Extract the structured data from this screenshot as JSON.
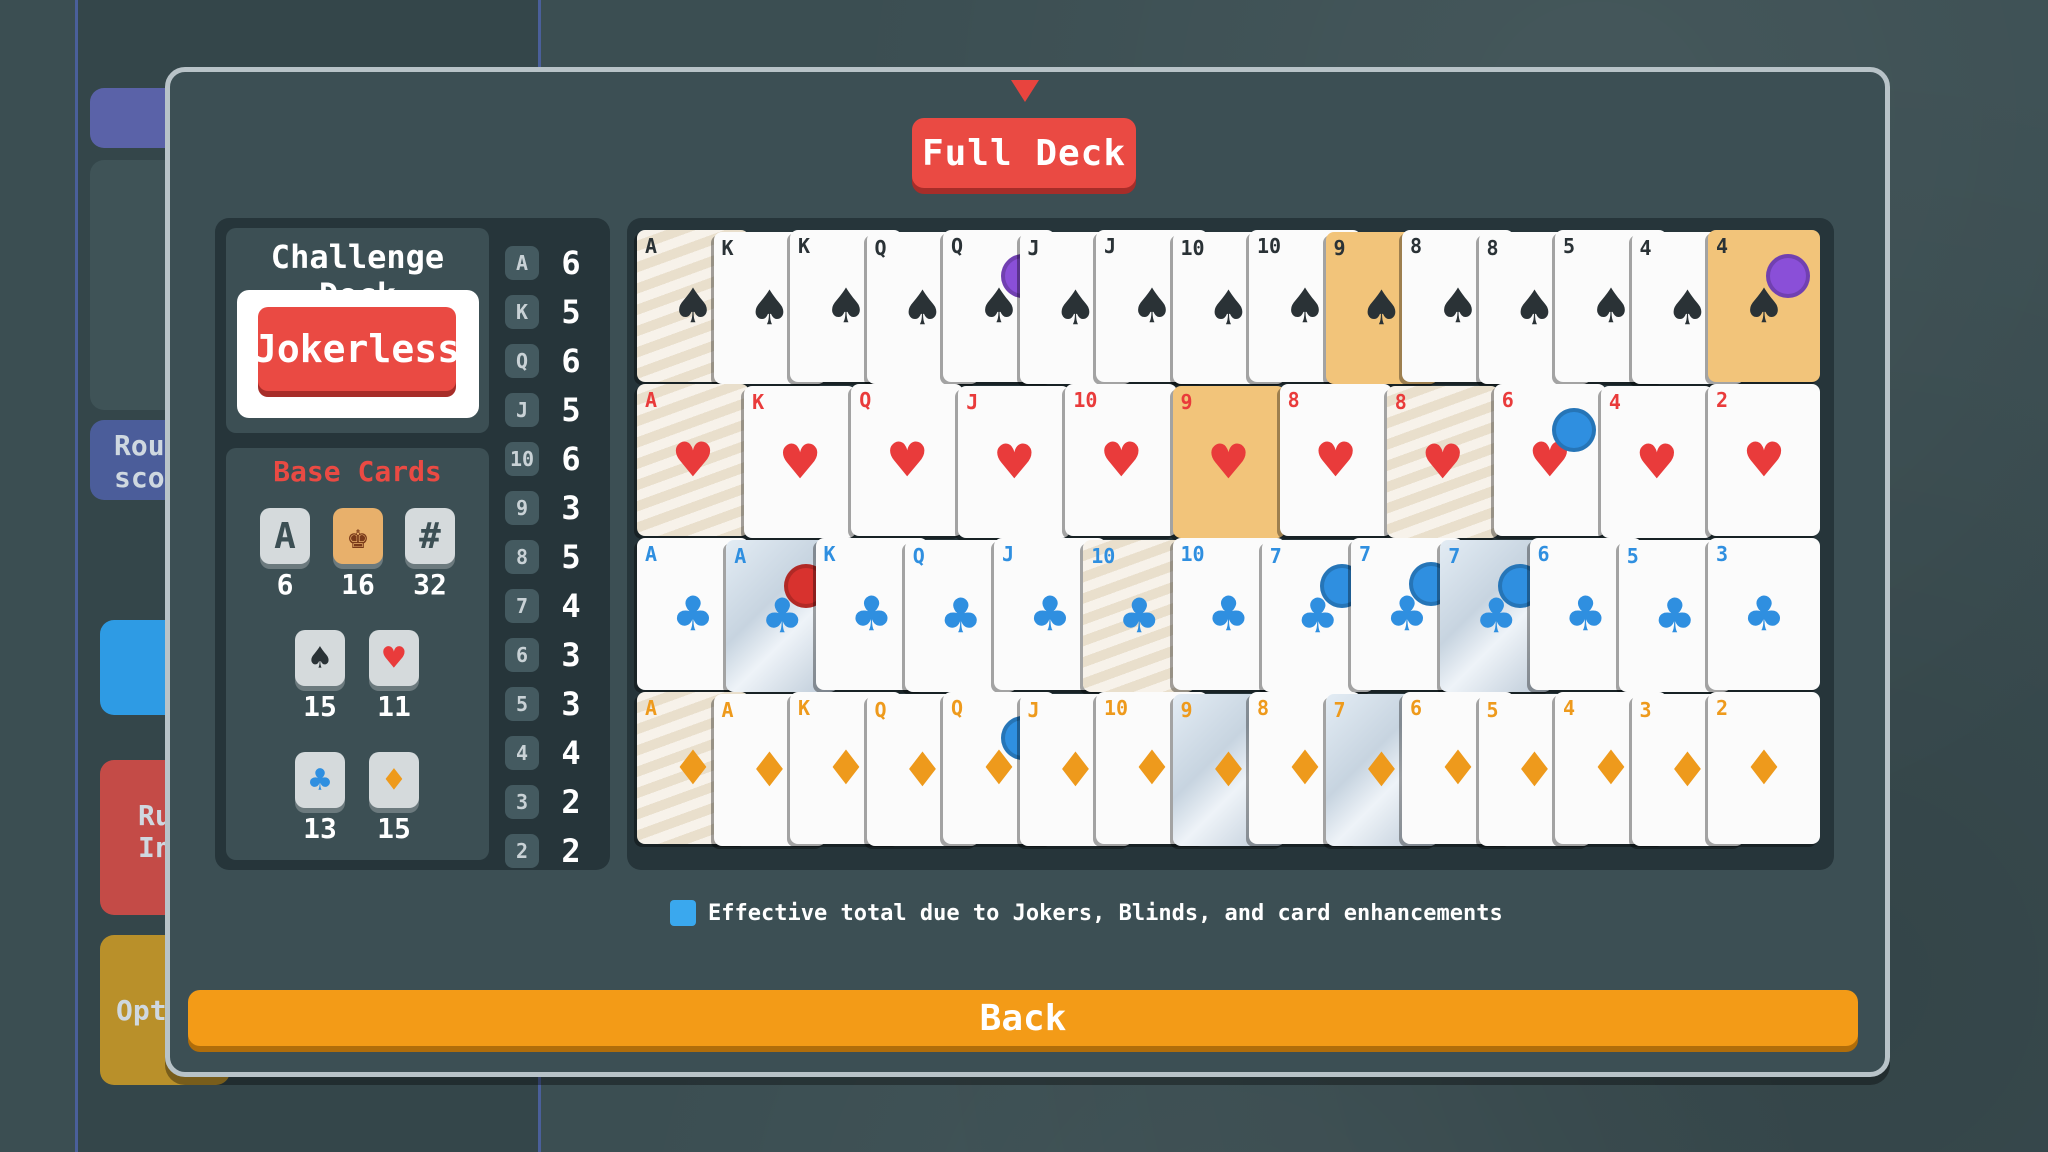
{
  "header": {
    "tab_label": "Full Deck"
  },
  "challenge": {
    "title": "Challenge Deck",
    "deck_name": "Jokerless"
  },
  "base_cards": {
    "title": "Base Cards",
    "aces": "6",
    "faces": "16",
    "numbers": "32",
    "spades": "15",
    "hearts": "11",
    "clubs": "13",
    "diamonds": "15",
    "ace_icon": "A",
    "number_icon": "#"
  },
  "rank_counts": [
    {
      "rank": "A",
      "count": "6"
    },
    {
      "rank": "K",
      "count": "5"
    },
    {
      "rank": "Q",
      "count": "6"
    },
    {
      "rank": "J",
      "count": "5"
    },
    {
      "rank": "10",
      "count": "6"
    },
    {
      "rank": "9",
      "count": "3"
    },
    {
      "rank": "8",
      "count": "5"
    },
    {
      "rank": "7",
      "count": "4"
    },
    {
      "rank": "6",
      "count": "3"
    },
    {
      "rank": "5",
      "count": "3"
    },
    {
      "rank": "4",
      "count": "4"
    },
    {
      "rank": "3",
      "count": "2"
    },
    {
      "rank": "2",
      "count": "2"
    }
  ],
  "card_rows": [
    {
      "suit": "spades",
      "glyph": "♠",
      "ranks": [
        "A",
        "K",
        "K",
        "Q",
        "Q",
        "J",
        "J",
        "10",
        "10",
        "9",
        "8",
        "8",
        "5",
        "4",
        "4"
      ],
      "styles": [
        "wild",
        "",
        "",
        "",
        "",
        "",
        "",
        "",
        "",
        "gold",
        "",
        "",
        "",
        "",
        "gold"
      ],
      "seals": [
        "",
        "",
        "",
        "",
        "purple",
        "",
        "",
        "",
        "",
        "",
        "",
        "",
        "",
        "",
        "purple"
      ]
    },
    {
      "suit": "hearts",
      "glyph": "♥",
      "ranks": [
        "A",
        "K",
        "Q",
        "J",
        "10",
        "9",
        "8",
        "8",
        "6",
        "4",
        "2"
      ],
      "styles": [
        "wild",
        "",
        "",
        "",
        "",
        "gold",
        "",
        "wild",
        "",
        "",
        ""
      ],
      "seals": [
        "",
        "",
        "",
        "",
        "",
        "",
        "",
        "",
        "blue",
        "",
        ""
      ]
    },
    {
      "suit": "clubs",
      "glyph": "♣",
      "ranks": [
        "A",
        "A",
        "K",
        "Q",
        "J",
        "10",
        "10",
        "7",
        "7",
        "7",
        "6",
        "5",
        "3"
      ],
      "styles": [
        "",
        "glass",
        "",
        "",
        "",
        "wild",
        "",
        "",
        "",
        "glass",
        "",
        "",
        ""
      ],
      "seals": [
        "",
        "red",
        "",
        "",
        "",
        "",
        "",
        "blue",
        "blue",
        "blue",
        "",
        "",
        ""
      ]
    },
    {
      "suit": "diamonds",
      "glyph": "♦",
      "ranks": [
        "A",
        "A",
        "K",
        "Q",
        "Q",
        "J",
        "10",
        "9",
        "8",
        "7",
        "6",
        "5",
        "4",
        "3",
        "2"
      ],
      "styles": [
        "wild",
        "",
        "",
        "",
        "",
        "",
        "",
        "glass",
        "",
        "glass",
        "",
        "",
        "",
        "",
        ""
      ],
      "seals": [
        "",
        "",
        "",
        "",
        "blue",
        "",
        "",
        "",
        "",
        "",
        "",
        "",
        "",
        "",
        ""
      ]
    }
  ],
  "legend": {
    "text": "Effective total due to Jokers, Blinds, and card enhancements",
    "color": "#3aa8ee"
  },
  "footer": {
    "back_label": "Back"
  },
  "background_ui": {
    "round_score_line1": "Rou",
    "round_score_line2": "sco",
    "run_info_line1": "Ru",
    "run_info_line2": "In",
    "options": "Opti"
  },
  "colors": {
    "accent_red": "#ea4a43",
    "accent_orange": "#f39b17",
    "panel_dark": "#26353a"
  }
}
